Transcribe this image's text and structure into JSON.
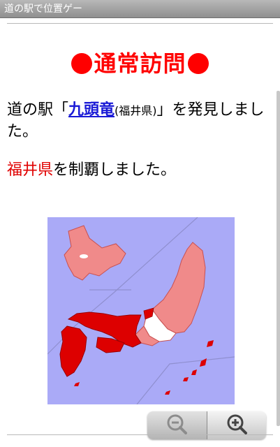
{
  "app": {
    "title": "道の駅で位置ゲー"
  },
  "visit": {
    "heading": "通常訪問",
    "msg_prefix": "道の駅「",
    "station_name": "九頭竜",
    "station_pref": "(福井県)",
    "msg_suffix": "」を発見しました。"
  },
  "conquest": {
    "prefecture": "福井県",
    "text": "を制覇しました。"
  },
  "map": {
    "colors": {
      "sea": "#aaaaf7",
      "visited": "#f08a8a",
      "conquered": "#dd0000",
      "unvisited": "#ffffff"
    }
  },
  "zoom": {
    "out_icon": "zoom-out-icon",
    "in_icon": "zoom-in-icon"
  }
}
